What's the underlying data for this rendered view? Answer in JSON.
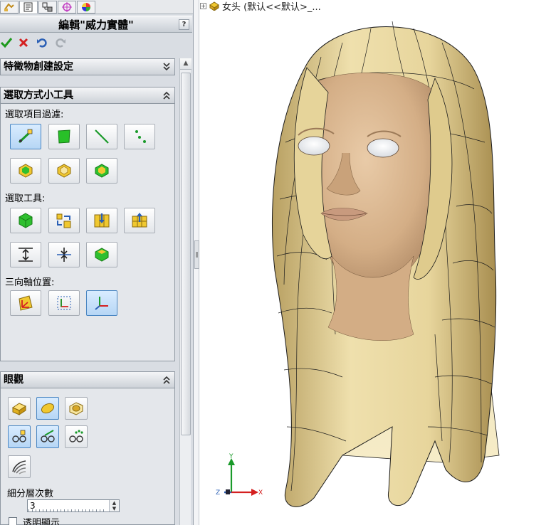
{
  "tabs": [
    {
      "name": "feature-manager"
    },
    {
      "name": "property-manager"
    },
    {
      "name": "configuration-manager"
    },
    {
      "name": "dimxpert-manager"
    },
    {
      "name": "display-manager"
    }
  ],
  "property_manager": {
    "title": "編輯\"威力實體\"",
    "help": "?"
  },
  "sections": {
    "feature_settings": {
      "title": "特徵物創建設定"
    },
    "selection_tools": {
      "title": "選取方式小工具",
      "filter_label": "選取項目過濾:",
      "tools_label": "選取工具:",
      "triad_label": "三向軸位置:"
    },
    "display": {
      "title": "眼觀",
      "subdivision_label": "細分層次數",
      "subdivision_value": "3",
      "transparent_label": "透明顯示"
    }
  },
  "tree": {
    "item_label": "女头 (默认<<默认>_..."
  },
  "triad": {
    "x": "X",
    "y": "Y",
    "z": "Z"
  },
  "colors": {
    "accent_blue": "#4a86c2",
    "confirm_green": "#1d9a1d",
    "cancel_red": "#d42020",
    "model_tan": "#e6d29a",
    "skin": "#d8b48c"
  }
}
